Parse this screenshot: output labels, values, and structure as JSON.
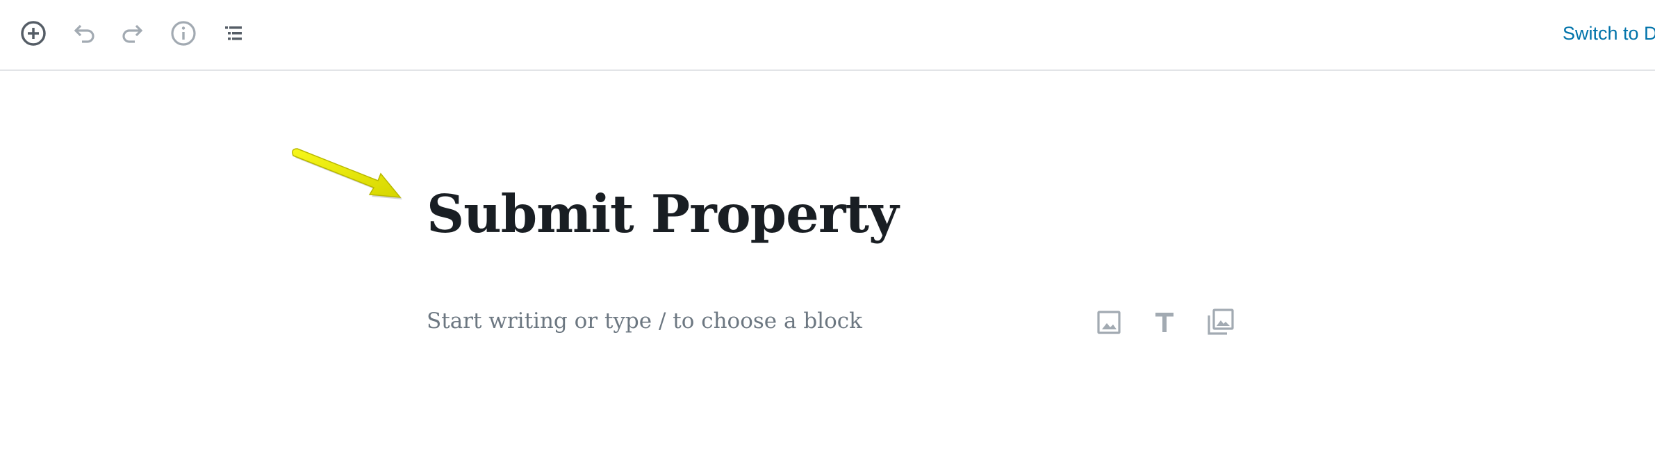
{
  "toolbar": {
    "add_block_icon": "plus-circle-icon",
    "undo_icon": "undo-icon",
    "redo_icon": "redo-icon",
    "info_icon": "info-icon",
    "outline_icon": "list-icon",
    "switch_label": "Switch to D"
  },
  "editor": {
    "title": "Submit Property",
    "block_placeholder": "Start writing or type / to choose a block",
    "inserters": [
      "image-icon",
      "heading-icon",
      "gallery-icon"
    ]
  },
  "annotation": {
    "arrow_color": "#e6e600"
  },
  "colors": {
    "link": "#0073aa",
    "title": "#191e23",
    "placeholder": "#6c7781",
    "icon_dark": "#555d66",
    "icon_muted": "#a2aab2"
  }
}
